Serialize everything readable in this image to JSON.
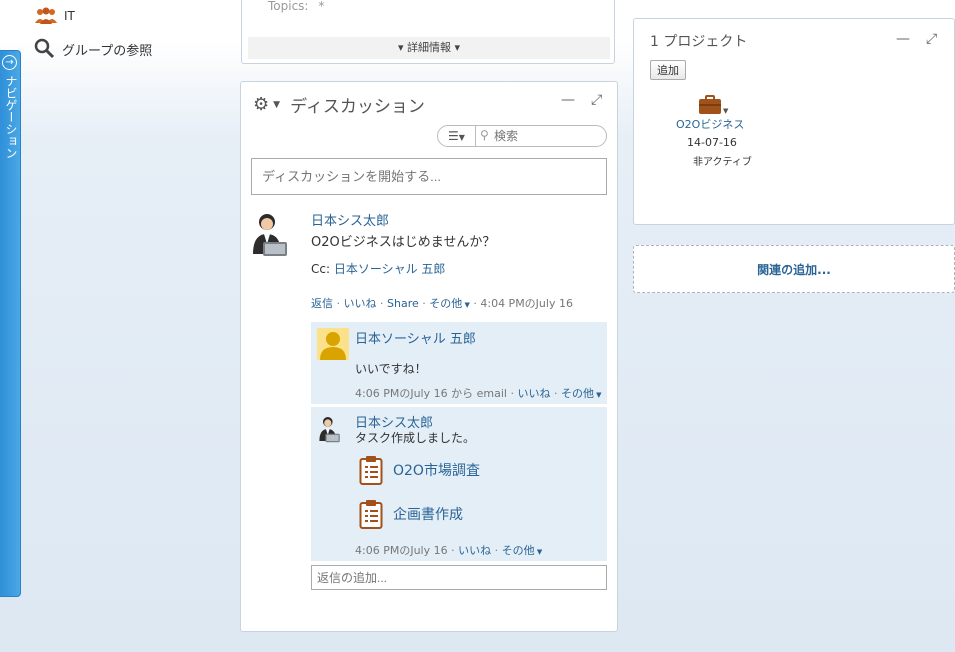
{
  "nav": {
    "label": "ナビゲーション"
  },
  "left": {
    "group_it": "IT",
    "browse_groups": "グループの参照"
  },
  "topics": {
    "label": "Topics:",
    "value": "*",
    "details_link": "▾ 詳細情報 ▾"
  },
  "discussion": {
    "title": "ディスカッション",
    "search_placeholder": "検索",
    "start_placeholder": "ディスカッションを開始する...",
    "post": {
      "author": "日本シス太郎",
      "text": "O2Oビジネスはじめませんか？",
      "cc_label": "Cc:",
      "cc_name": "日本ソーシャル 五郎",
      "actions": {
        "reply": "返信",
        "like": "いいね",
        "share": "Share",
        "more": "その他",
        "time": "4:04 PMのJuly 16"
      }
    },
    "replies": [
      {
        "author": "日本ソーシャル 五郎",
        "text": "いいですね！",
        "time": "4:06 PMのJuly 16",
        "via": "から email",
        "like": "いいね",
        "more": "その他"
      },
      {
        "author": "日本シス太郎",
        "text": "タスク作成しました。",
        "tasks": [
          "O2O市場調査",
          "企画書作成"
        ],
        "time": "4:06 PMのJuly 16",
        "like": "いいね",
        "more": "その他"
      }
    ],
    "reply_placeholder": "返信の追加..."
  },
  "project": {
    "title": "1 プロジェクト",
    "add_button": "追加",
    "item": {
      "name": "O2Oビジネス",
      "date": "14-07-16",
      "status": "非アクティブ"
    }
  },
  "related": {
    "add_link": "関連の追加..."
  },
  "colors": {
    "link": "#2a6496",
    "nav": "#3a9ae0",
    "reply_bg": "#e4eef7",
    "briefcase": "#a0521a"
  }
}
